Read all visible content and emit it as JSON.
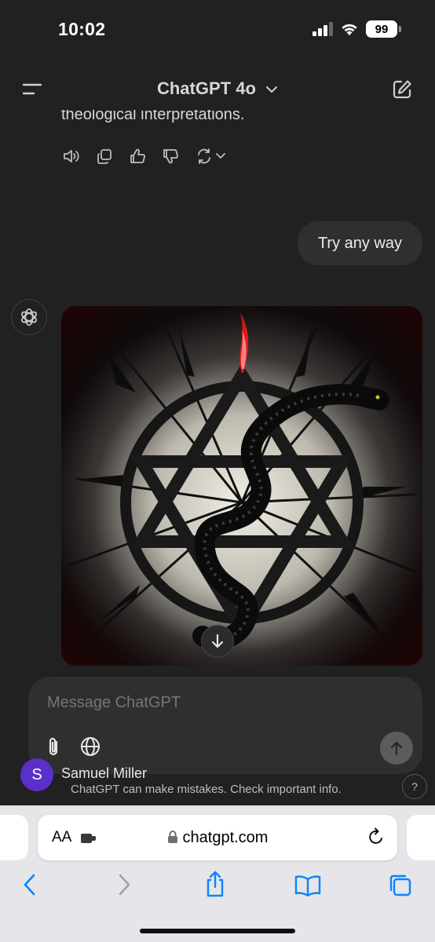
{
  "status_bar": {
    "time": "10:02",
    "battery": "99"
  },
  "header": {
    "title": "ChatGPT 4o"
  },
  "conversation": {
    "previous_text": "theological interpretations.",
    "user_message": "Try any way"
  },
  "composer": {
    "placeholder": "Message ChatGPT"
  },
  "account": {
    "initial": "S",
    "name": "Samuel Miller"
  },
  "footer": {
    "disclaimer": "ChatGPT can make mistakes. Check important info.",
    "help": "?"
  },
  "browser": {
    "aa_label": "AA",
    "url": "chatgpt.com"
  },
  "icons": [
    "menu-icon",
    "chevron-down-icon",
    "new-chat-icon",
    "speaker-icon",
    "copy-icon",
    "thumbs-up-icon",
    "thumbs-down-icon",
    "regenerate-icon",
    "openai-logo-icon",
    "arrow-down-icon",
    "paperclip-icon",
    "globe-icon",
    "arrow-up-icon",
    "lock-icon",
    "reload-icon",
    "back-icon",
    "forward-icon",
    "share-icon",
    "bookmarks-icon",
    "tabs-icon"
  ],
  "colors": {
    "background": "#212121",
    "bubble": "#2f2f2f",
    "avatar": "#5b2fc9",
    "safari_accent": "#0a84ff"
  }
}
